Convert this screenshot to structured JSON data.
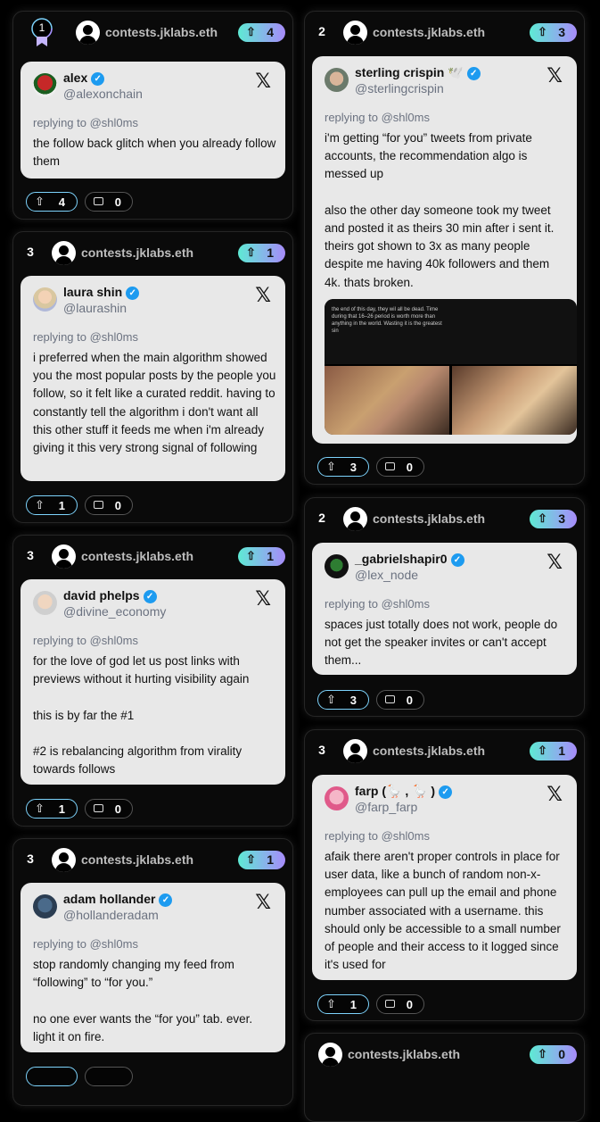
{
  "site": "contests.jklabs.eth",
  "reply_prefix": "replying to @shl0ms",
  "left_cards": [
    {
      "rank": "1",
      "score": "4",
      "author": "alex",
      "handle": "@alexonchain",
      "text": "the follow back glitch when you already follow them",
      "votes": "4",
      "comments": "0"
    },
    {
      "rank": "3",
      "score": "1",
      "author": "laura shin",
      "handle": "@laurashin",
      "text": "i preferred when the main algorithm showed you the most popular posts by the people you follow, so it felt like a curated reddit. having to constantly tell the algorithm i don't want all this other stuff it feeds me when i'm already giving it this very strong signal of following",
      "votes": "1",
      "comments": "0"
    },
    {
      "rank": "3",
      "score": "1",
      "author": "david phelps",
      "handle": "@divine_economy",
      "text": "for the love of god let us post links with previews without it hurting visibility again\n\nthis is by far the #1\n\n#2 is rebalancing algorithm from virality towards follows",
      "votes": "1",
      "comments": "0"
    },
    {
      "rank": "3",
      "score": "1",
      "author": "adam hollander",
      "handle": "@hollanderadam",
      "text": "stop randomly changing my feed from “following” to “for you.”\n\nno one ever wants the “for you” tab. ever. light it on fire."
    }
  ],
  "right_cards": [
    {
      "rank": "2",
      "score": "3",
      "author": "sterling crispin 🕊️",
      "handle": "@sterlingcrispin",
      "text": "i'm getting “for you” tweets from private accounts, the recommendation algo is messed up\n\nalso the other day someone took my tweet and posted it as theirs 30 min after i sent it. theirs got shown to 3x as many people despite me having 40k followers and them 4k. thats broken.",
      "media_caption": "the end of this day, they wil all be dead. Time during that 16–26 period is worth more than anything in the world. Wasting it is the greatest sin",
      "votes": "3",
      "comments": "0"
    },
    {
      "rank": "2",
      "score": "3",
      "author": "_gabrielshapir0",
      "handle": "@lex_node",
      "text": "spaces just totally does not work, people do not get the speaker invites or can't accept them...",
      "votes": "3",
      "comments": "0"
    },
    {
      "rank": "3",
      "score": "1",
      "author": "farp (🪿 , 🪿 )",
      "handle": "@farp_farp",
      "text": "afaik there aren't proper controls in place for user data, like a bunch of random non-x-employees can pull up the email and phone number associated with a username. this should only be accessible to a small number of people and their access to it logged since it's used for",
      "votes": "1",
      "comments": "0"
    },
    {
      "score": "0"
    }
  ],
  "icons": {
    "upvote": "⇧",
    "x_logo": "𝕏",
    "verified": "✓"
  },
  "colors": {
    "badge_gradient_start": "#5eead4",
    "badge_gradient_end": "#a78bfa",
    "verified": "#1d9bf0"
  }
}
